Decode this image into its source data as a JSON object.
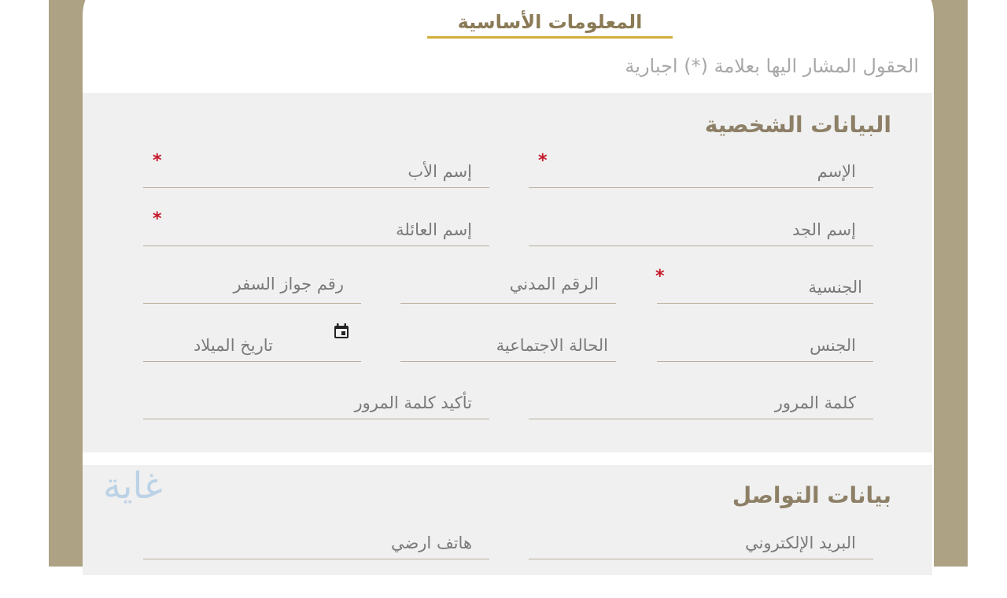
{
  "tab": {
    "title": "المعلومات الأساسية"
  },
  "note": {
    "required_text": "الحقول المشار اليها بعلامة (*) اجبارية"
  },
  "personal": {
    "title": "البيانات الشخصية",
    "fields": {
      "name": {
        "label": "الإسم",
        "required": true
      },
      "father_name": {
        "label": "إسم الأب",
        "required": true
      },
      "grandfather_name": {
        "label": "إسم الجد",
        "required": false
      },
      "family_name": {
        "label": "إسم العائلة",
        "required": true
      },
      "nationality": {
        "label": "الجنسية",
        "required": true
      },
      "civil_id": {
        "label": "الرقم المدني",
        "required": false
      },
      "passport_number": {
        "label": "رقم جواز السفر",
        "required": false
      },
      "gender": {
        "label": "الجنس",
        "required": false
      },
      "marital_status": {
        "label": "الحالة الاجتماعية",
        "required": false
      },
      "birth_date": {
        "label": "تاريخ الميلاد",
        "required": false,
        "icon": "calendar-icon"
      },
      "password": {
        "label": "كلمة المرور",
        "required": false
      },
      "confirm_password": {
        "label": "تأكيد كلمة المرور",
        "required": false
      }
    }
  },
  "contact": {
    "title": "بيانات التواصل",
    "fields": {
      "email": {
        "label": "البريد الإلكتروني",
        "required": false
      },
      "landline": {
        "label": "هاتف ارضي",
        "required": false
      }
    }
  },
  "logo": {
    "text": "غاية"
  },
  "colors": {
    "frame": "#aea285",
    "accent_underline": "#d1ad3a",
    "section_bg": "#f0f0f0",
    "required_star": "#c4182a",
    "section_title": "#8d8066"
  },
  "symbols": {
    "required_star": "*"
  }
}
